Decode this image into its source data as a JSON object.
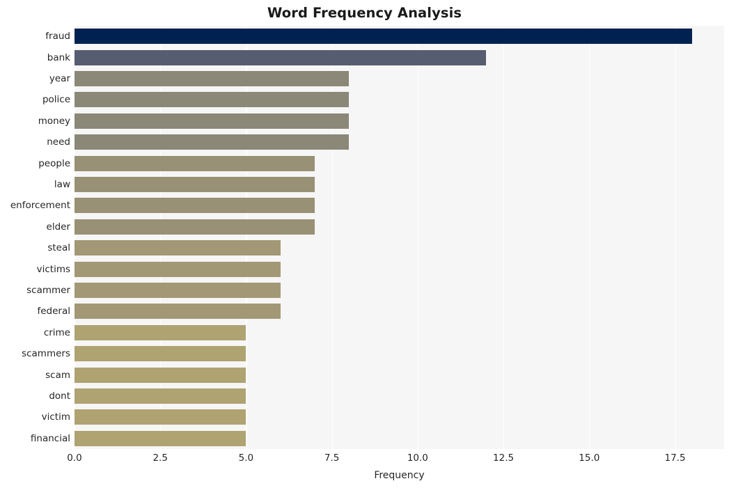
{
  "chart_data": {
    "type": "bar",
    "orientation": "horizontal",
    "title": "Word Frequency Analysis",
    "xlabel": "Frequency",
    "ylabel": "",
    "categories": [
      "fraud",
      "bank",
      "year",
      "police",
      "money",
      "need",
      "people",
      "law",
      "enforcement",
      "elder",
      "steal",
      "victims",
      "scammer",
      "federal",
      "crime",
      "scammers",
      "scam",
      "dont",
      "victim",
      "financial"
    ],
    "values": [
      18,
      12,
      8,
      8,
      8,
      8,
      7,
      7,
      7,
      7,
      6,
      6,
      6,
      6,
      5,
      5,
      5,
      5,
      5,
      5
    ],
    "bar_colors": [
      "#012250",
      "#575D70",
      "#8B8878",
      "#8B8878",
      "#8B8878",
      "#8B8878",
      "#999175",
      "#999175",
      "#999175",
      "#999175",
      "#A39875",
      "#A39875",
      "#A39875",
      "#A39875",
      "#AFA372",
      "#AFA372",
      "#AFA372",
      "#AFA372",
      "#AFA372",
      "#AFA372"
    ],
    "xlim": [
      0.0,
      18.93
    ],
    "xticks": [
      0.0,
      2.5,
      5.0,
      7.5,
      10.0,
      12.5,
      15.0,
      17.5
    ],
    "xtick_labels": [
      "0.0",
      "2.5",
      "5.0",
      "7.5",
      "10.0",
      "12.5",
      "15.0",
      "17.5"
    ],
    "grid": "vertical",
    "legend": "none",
    "plot_background": "#F6F6F6",
    "gridline_color": "#FFFFFF",
    "figure_background": "#FFFFFF",
    "text_color": "#262626",
    "title_color": "#1A1A1A"
  }
}
